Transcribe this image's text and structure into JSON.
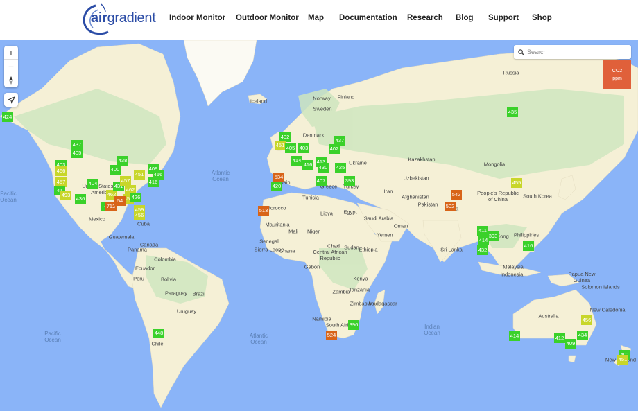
{
  "header": {
    "logo_bold": "air",
    "logo_light": "gradient",
    "nav": [
      {
        "label": "Indoor Monitor"
      },
      {
        "label": "Outdoor Monitor"
      },
      {
        "label": "Map"
      },
      {
        "label": "Documentation"
      },
      {
        "label": "Research"
      },
      {
        "label": "Blog"
      },
      {
        "label": "Support"
      },
      {
        "label": "Shop"
      }
    ]
  },
  "map": {
    "controls": {
      "zoom_in": "+",
      "zoom_out": "−",
      "compass": "compass-icon",
      "locate": "locate-icon"
    },
    "search": {
      "placeholder": "Search",
      "value": ""
    },
    "legend": {
      "line1": "CO2",
      "line2": "ppm",
      "color": "#e0603a"
    },
    "colors": {
      "good": "#3ad12a",
      "moderate": "#c8d62a",
      "high": "#d86418"
    },
    "labels": [
      {
        "text": "Canada",
        "kind": "land"
      },
      {
        "text": "United States of America",
        "kind": "land"
      },
      {
        "text": "Mexico",
        "kind": "land"
      },
      {
        "text": "Cuba",
        "kind": "land"
      },
      {
        "text": "Guatemala",
        "kind": "land"
      },
      {
        "text": "Panama",
        "kind": "land"
      },
      {
        "text": "Colombia",
        "kind": "land"
      },
      {
        "text": "Ecuador",
        "kind": "land"
      },
      {
        "text": "Peru",
        "kind": "land"
      },
      {
        "text": "Brazil",
        "kind": "land"
      },
      {
        "text": "Bolivia",
        "kind": "land"
      },
      {
        "text": "Paraguay",
        "kind": "land"
      },
      {
        "text": "Uruguay",
        "kind": "land"
      },
      {
        "text": "Chile",
        "kind": "land"
      },
      {
        "text": "Iceland",
        "kind": "land"
      },
      {
        "text": "Norway",
        "kind": "land"
      },
      {
        "text": "Sweden",
        "kind": "land"
      },
      {
        "text": "Finland",
        "kind": "land"
      },
      {
        "text": "Denmark",
        "kind": "land"
      },
      {
        "text": "Ukraine",
        "kind": "land"
      },
      {
        "text": "Spain",
        "kind": "land"
      },
      {
        "text": "Greece",
        "kind": "land"
      },
      {
        "text": "Turkey",
        "kind": "land"
      },
      {
        "text": "Russia",
        "kind": "land"
      },
      {
        "text": "Kazakhstan",
        "kind": "land"
      },
      {
        "text": "Mongolia",
        "kind": "land"
      },
      {
        "text": "Uzbekistan",
        "kind": "land"
      },
      {
        "text": "Iran",
        "kind": "land"
      },
      {
        "text": "Afghanistan",
        "kind": "land"
      },
      {
        "text": "Pakistan",
        "kind": "land"
      },
      {
        "text": "People's Republic of China",
        "kind": "land"
      },
      {
        "text": "South Korea",
        "kind": "land"
      },
      {
        "text": "India",
        "kind": "land"
      },
      {
        "text": "Sri Lanka",
        "kind": "land"
      },
      {
        "text": "Hong Kong",
        "kind": "land"
      },
      {
        "text": "Philippines",
        "kind": "land"
      },
      {
        "text": "Malaysia",
        "kind": "land"
      },
      {
        "text": "Indonesia",
        "kind": "land"
      },
      {
        "text": "Papua New Guinea",
        "kind": "land"
      },
      {
        "text": "Solomon Islands",
        "kind": "land"
      },
      {
        "text": "New Caledonia",
        "kind": "land"
      },
      {
        "text": "Australia",
        "kind": "land"
      },
      {
        "text": "Tunisia",
        "kind": "land"
      },
      {
        "text": "Morocco",
        "kind": "land"
      },
      {
        "text": "Libya",
        "kind": "land"
      },
      {
        "text": "Egypt",
        "kind": "land"
      },
      {
        "text": "Saudi Arabia",
        "kind": "land"
      },
      {
        "text": "Oman",
        "kind": "land"
      },
      {
        "text": "Yemen",
        "kind": "land"
      },
      {
        "text": "Mauritania",
        "kind": "land"
      },
      {
        "text": "Mali",
        "kind": "land"
      },
      {
        "text": "Niger",
        "kind": "land"
      },
      {
        "text": "Chad",
        "kind": "land"
      },
      {
        "text": "Sudan",
        "kind": "land"
      },
      {
        "text": "Senegal",
        "kind": "land"
      },
      {
        "text": "Sierra Leone",
        "kind": "land"
      },
      {
        "text": "Ghana",
        "kind": "land"
      },
      {
        "text": "Central African Republic",
        "kind": "land"
      },
      {
        "text": "Ethiopia",
        "kind": "land"
      },
      {
        "text": "Gabon",
        "kind": "land"
      },
      {
        "text": "Kenya",
        "kind": "land"
      },
      {
        "text": "Tanzania",
        "kind": "land"
      },
      {
        "text": "Zambia",
        "kind": "land"
      },
      {
        "text": "Zimbabwe",
        "kind": "land"
      },
      {
        "text": "Namibia",
        "kind": "land"
      },
      {
        "text": "Madagascar",
        "kind": "land"
      },
      {
        "text": "South Africa",
        "kind": "land"
      },
      {
        "text": "New Zealand",
        "kind": "land"
      },
      {
        "text": "Pacific Ocean",
        "kind": "ocean"
      },
      {
        "text": "Atlantic Ocean",
        "kind": "ocean"
      },
      {
        "text": "Atlantic Ocean",
        "kind": "ocean"
      },
      {
        "text": "Pacific Ocean",
        "kind": "ocean"
      },
      {
        "text": "Indian Ocean",
        "kind": "ocean"
      }
    ],
    "markers": [
      {
        "value": "424",
        "level": "good"
      },
      {
        "value": "437",
        "level": "good"
      },
      {
        "value": "405",
        "level": "good"
      },
      {
        "value": "403",
        "level": "good"
      },
      {
        "value": "466",
        "level": "moderate"
      },
      {
        "value": "457",
        "level": "moderate"
      },
      {
        "value": "41",
        "level": "good"
      },
      {
        "value": "493",
        "level": "moderate"
      },
      {
        "value": "436",
        "level": "good"
      },
      {
        "value": "404",
        "level": "good"
      },
      {
        "value": "462",
        "level": "moderate"
      },
      {
        "value": "438",
        "level": "good"
      },
      {
        "value": "400",
        "level": "good"
      },
      {
        "value": "431",
        "level": "good"
      },
      {
        "value": "457",
        "level": "moderate"
      },
      {
        "value": "462",
        "level": "moderate"
      },
      {
        "value": "451",
        "level": "moderate"
      },
      {
        "value": "409",
        "level": "good"
      },
      {
        "value": "416",
        "level": "good"
      },
      {
        "value": "416",
        "level": "good"
      },
      {
        "value": "459",
        "level": "moderate"
      },
      {
        "value": "41",
        "level": "good"
      },
      {
        "value": "712",
        "level": "high"
      },
      {
        "value": "54",
        "level": "high"
      },
      {
        "value": "426",
        "level": "good"
      },
      {
        "value": "459",
        "level": "moderate"
      },
      {
        "value": "456",
        "level": "moderate"
      },
      {
        "value": "402",
        "level": "good"
      },
      {
        "value": "451",
        "level": "moderate"
      },
      {
        "value": "405",
        "level": "good"
      },
      {
        "value": "403",
        "level": "good"
      },
      {
        "value": "414",
        "level": "good"
      },
      {
        "value": "416",
        "level": "good"
      },
      {
        "value": "413",
        "level": "good"
      },
      {
        "value": "430",
        "level": "good"
      },
      {
        "value": "437",
        "level": "good"
      },
      {
        "value": "402",
        "level": "good"
      },
      {
        "value": "425",
        "level": "good"
      },
      {
        "value": "407",
        "level": "good"
      },
      {
        "value": "393",
        "level": "good"
      },
      {
        "value": "534",
        "level": "high"
      },
      {
        "value": "420",
        "level": "good"
      },
      {
        "value": "513",
        "level": "high"
      },
      {
        "value": "435",
        "level": "good"
      },
      {
        "value": "542",
        "level": "high"
      },
      {
        "value": "502",
        "level": "high"
      },
      {
        "value": "455",
        "level": "moderate"
      },
      {
        "value": "411",
        "level": "good"
      },
      {
        "value": "414",
        "level": "good"
      },
      {
        "value": "393",
        "level": "good"
      },
      {
        "value": "432",
        "level": "good"
      },
      {
        "value": "416",
        "level": "good"
      },
      {
        "value": "396",
        "level": "good"
      },
      {
        "value": "524",
        "level": "high"
      },
      {
        "value": "448",
        "level": "good"
      },
      {
        "value": "414",
        "level": "good"
      },
      {
        "value": "412",
        "level": "good"
      },
      {
        "value": "409",
        "level": "good"
      },
      {
        "value": "434",
        "level": "good"
      },
      {
        "value": "456",
        "level": "moderate"
      },
      {
        "value": "401",
        "level": "good"
      },
      {
        "value": "451",
        "level": "moderate"
      }
    ]
  }
}
